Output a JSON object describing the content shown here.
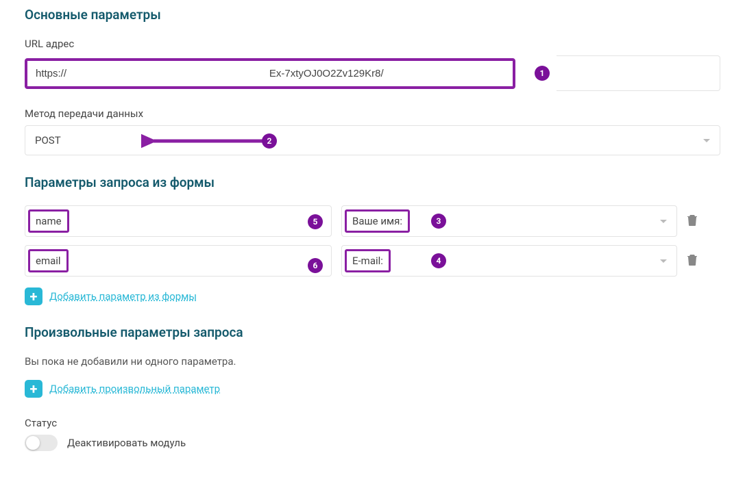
{
  "sections": {
    "main": "Основные параметры",
    "formParams": "Параметры запроса из формы",
    "customParams": "Произвольные параметры запроса"
  },
  "url": {
    "label": "URL адрес",
    "left": "https://",
    "right": "Ex-7xtyOJ0O2Zv129Kr8/"
  },
  "method": {
    "label": "Метод передачи данных",
    "value": "POST"
  },
  "params": [
    {
      "key": "name",
      "mapLabel": "Ваше имя:",
      "keyBadge": "5",
      "mapBadge": "3"
    },
    {
      "key": "email",
      "mapLabel": "E-mail:",
      "keyBadge": "6",
      "mapBadge": "4"
    }
  ],
  "addFormParam": "Добавить параметр из формы",
  "addCustomParam": "Добавить произвольный параметр",
  "emptyCustom": "Вы пока не добавили ни одного параметра.",
  "status": {
    "label": "Статус",
    "toggleLabel": "Деактивировать модуль"
  },
  "badges": {
    "url": "1",
    "method": "2"
  }
}
